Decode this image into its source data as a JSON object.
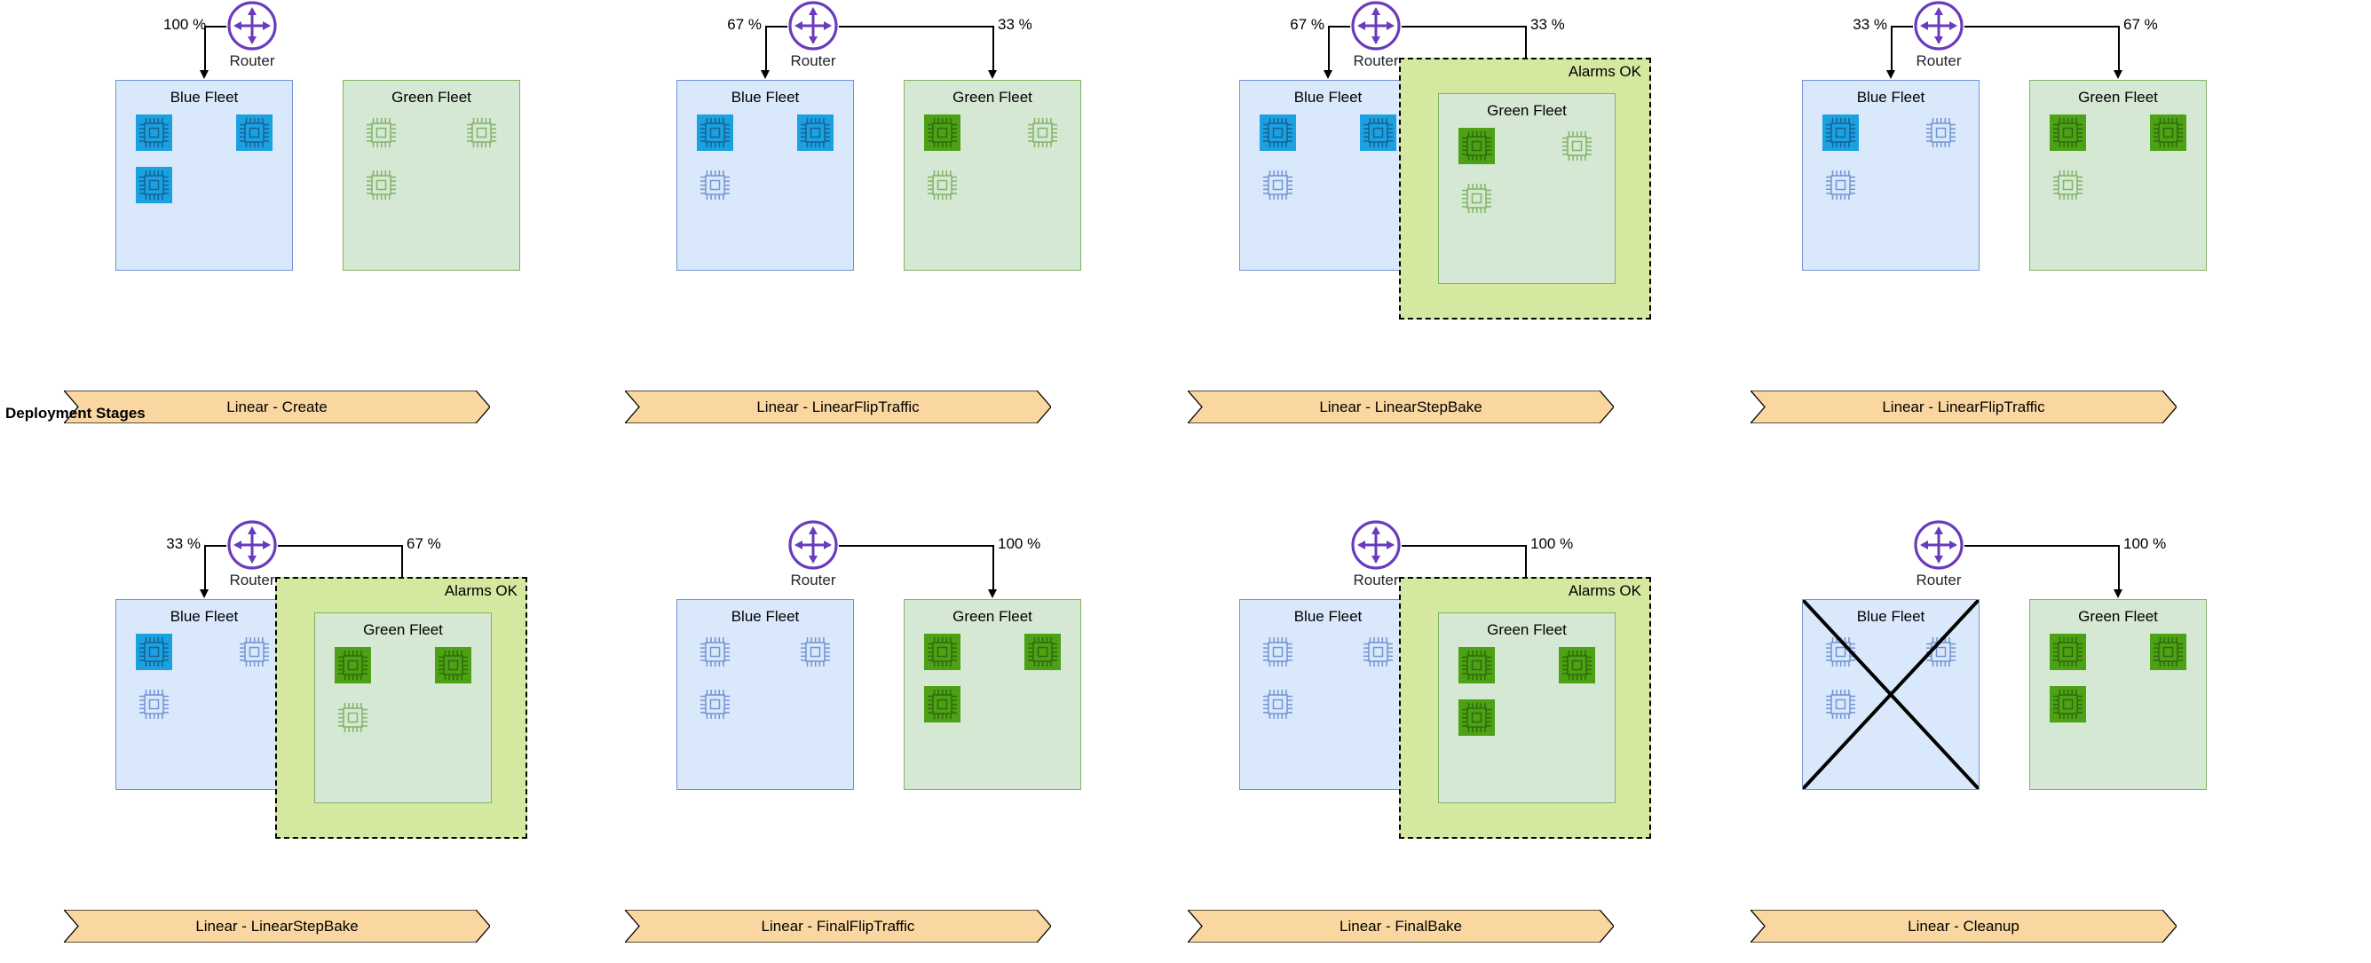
{
  "diagram": {
    "stages_axis_label": "Deployment Stages",
    "router_label": "Router",
    "blue_fleet_label": "Blue Fleet",
    "green_fleet_label": "Green Fleet",
    "alarms_label": "Alarms OK",
    "colors": {
      "blue_fleet_fill": "#dae8fc",
      "blue_fleet_stroke": "#7294d2",
      "green_fleet_fill": "#d5e8d4",
      "green_fleet_stroke": "#82b366",
      "blue_chip_active": "#1ba1e2",
      "blue_chip_inactive_stroke": "#7294d2",
      "green_chip_active": "#4ca114",
      "green_chip_inactive_stroke": "#82b366",
      "alarm_fill": "#d5e8a0",
      "alarm_stroke": "#000000",
      "router_stroke": "#6a3bbd",
      "banner_fill": "#fad7a0",
      "banner_stroke": "#000000"
    }
  },
  "panels": [
    {
      "id": "linear-create",
      "stage": "Linear - Create",
      "blue_pct": "100 %",
      "green_pct": "",
      "blue_traffic": true,
      "green_traffic": false,
      "blue_active_chips": 3,
      "green_active_chips": 0,
      "alarms": false,
      "blue_terminated": false
    },
    {
      "id": "linear-linearfliptraffic-1",
      "stage": "Linear - LinearFlipTraffic",
      "blue_pct": "67 %",
      "green_pct": "33 %",
      "blue_traffic": true,
      "green_traffic": true,
      "blue_active_chips": 2,
      "green_active_chips": 1,
      "alarms": false,
      "blue_terminated": false
    },
    {
      "id": "linear-linearstepbake-1",
      "stage": "Linear - LinearStepBake",
      "blue_pct": "67 %",
      "green_pct": "33 %",
      "blue_traffic": true,
      "green_traffic": true,
      "blue_active_chips": 2,
      "green_active_chips": 1,
      "alarms": true,
      "blue_terminated": false
    },
    {
      "id": "linear-linearfliptraffic-2",
      "stage": "Linear - LinearFlipTraffic",
      "blue_pct": "33 %",
      "green_pct": "67 %",
      "blue_traffic": true,
      "green_traffic": true,
      "blue_active_chips": 1,
      "green_active_chips": 2,
      "alarms": false,
      "blue_terminated": false
    },
    {
      "id": "linear-linearstepbake-2",
      "stage": "Linear - LinearStepBake",
      "blue_pct": "33 %",
      "green_pct": "67 %",
      "blue_traffic": true,
      "green_traffic": true,
      "blue_active_chips": 1,
      "green_active_chips": 2,
      "alarms": true,
      "blue_terminated": false
    },
    {
      "id": "linear-finalfliptraffic",
      "stage": "Linear - FinalFlipTraffic",
      "blue_pct": "",
      "green_pct": "100 %",
      "blue_traffic": false,
      "green_traffic": true,
      "blue_active_chips": 0,
      "green_active_chips": 3,
      "alarms": false,
      "blue_terminated": false
    },
    {
      "id": "linear-finalbake",
      "stage": "Linear - FinalBake",
      "blue_pct": "",
      "green_pct": "100 %",
      "blue_traffic": false,
      "green_traffic": true,
      "blue_active_chips": 0,
      "green_active_chips": 3,
      "alarms": true,
      "blue_terminated": false
    },
    {
      "id": "linear-cleanup",
      "stage": "Linear - Cleanup",
      "blue_pct": "",
      "green_pct": "100 %",
      "blue_traffic": false,
      "green_traffic": true,
      "blue_active_chips": 0,
      "green_active_chips": 3,
      "alarms": false,
      "blue_terminated": true
    }
  ],
  "icons": {
    "router": "router-four-way-arrow-icon",
    "chip": "cpu-chip-icon",
    "cross": "terminated-cross-icon"
  }
}
